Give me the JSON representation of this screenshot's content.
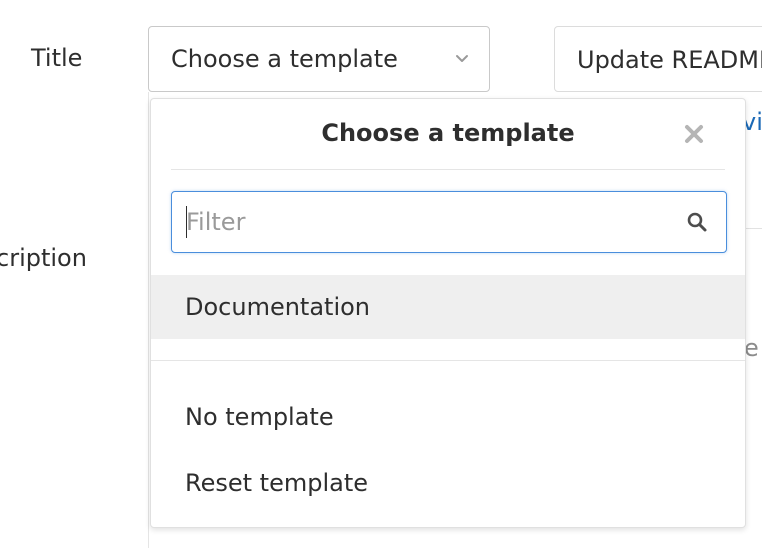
{
  "form": {
    "title_label": "Title",
    "description_label": "cription",
    "template_trigger_label": "Choose a template",
    "title_value": "Update README.md",
    "bg_link_fragment": "vi",
    "bg_text_fragment": "e"
  },
  "dropdown": {
    "title": "Choose a template",
    "filter": {
      "placeholder": "Filter",
      "value": ""
    },
    "items": [
      {
        "label": "Documentation",
        "active": true
      }
    ],
    "actions": [
      {
        "label": "No template"
      },
      {
        "label": "Reset template"
      }
    ]
  },
  "colors": {
    "accent": "#4a8edc",
    "link": "#1b69b6",
    "active_bg": "#efefef",
    "text": "#2e2e2e"
  },
  "icons": {
    "trigger": "chevron-down-icon",
    "close": "close-icon",
    "filter": "search-icon"
  }
}
